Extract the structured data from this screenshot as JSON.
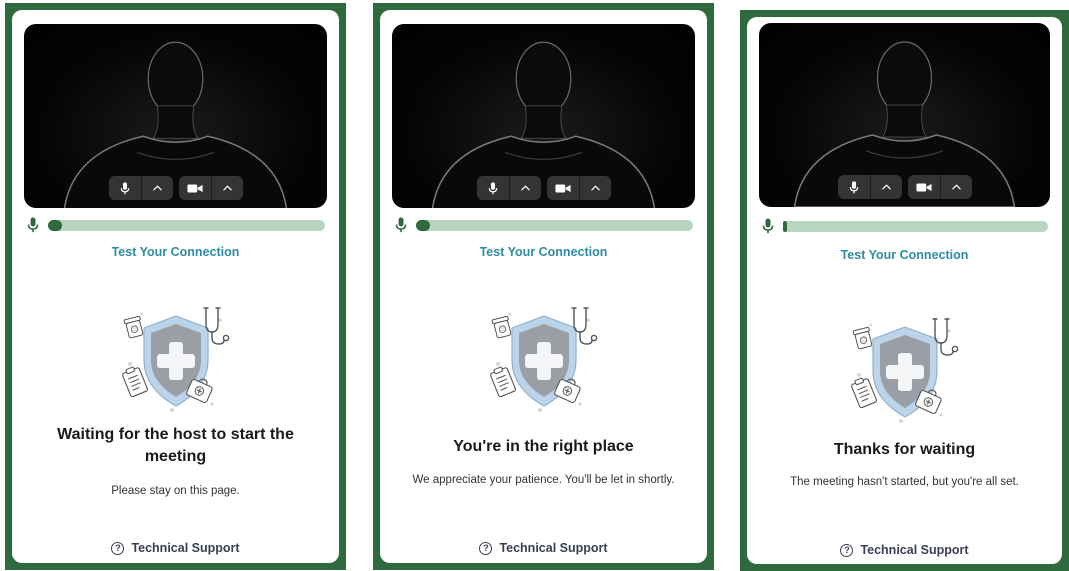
{
  "panels": [
    {
      "title": "Waiting for the host to start the meeting",
      "subtitle": "Please stay on this page.",
      "test_link": "Test Your Connection",
      "support": "Technical Support",
      "mic_level": 0.05
    },
    {
      "title": "You're in the right place",
      "subtitle": "We appreciate your patience. You'll be let in shortly.",
      "test_link": "Test Your Connection",
      "support": "Technical Support",
      "mic_level": 0.05
    },
    {
      "title": "Thanks for waiting",
      "subtitle": "The meeting hasn't started, but you're all set.",
      "test_link": "Test Your Connection",
      "support": "Technical Support",
      "mic_level": 0.01
    }
  ],
  "icons": {
    "mic": "microphone-icon",
    "camera": "camera-icon",
    "chevron": "chevron-up-icon",
    "help": "question-circle-icon",
    "illustration": "medical-shield-illustration"
  },
  "colors": {
    "frame": "#2f6a3e",
    "link": "#2e8ca3",
    "level_track": "#b9d4c1",
    "level_fill": "#2f6a3e"
  }
}
